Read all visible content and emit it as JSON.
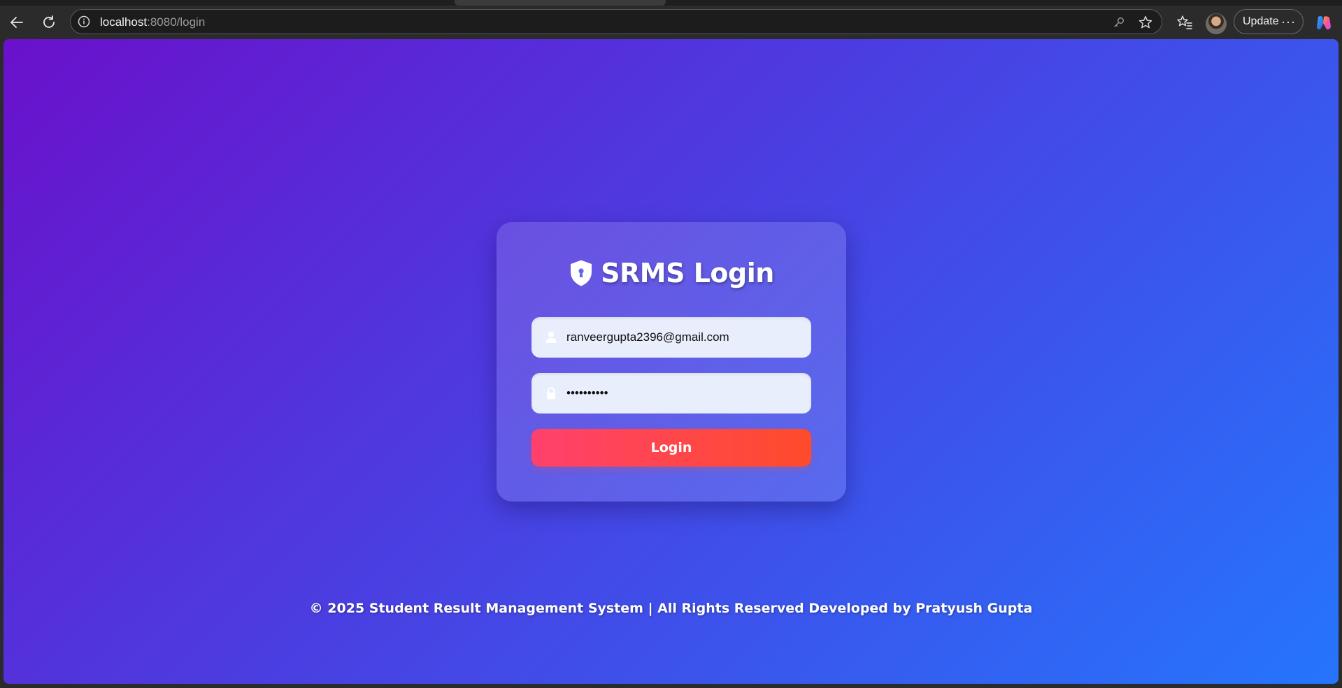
{
  "browser": {
    "url_host": "localhost",
    "url_path": ":8080/login",
    "update_label": "Update",
    "more_label": "···"
  },
  "login": {
    "title": "SRMS Login",
    "email_value": "ranveergupta2396@gmail.com",
    "password_value": "••••••••••",
    "button_label": "Login"
  },
  "footer": {
    "text": "© 2025 Student Result Management System | All Rights Reserved Developed by Pratyush Gupta"
  },
  "colors": {
    "gradient_start": "#6a11cb",
    "gradient_end": "#2575fc",
    "button_start": "#ff416c",
    "button_end": "#ff4b2b"
  },
  "icons": {
    "back": "back-arrow-icon",
    "reload": "reload-icon",
    "site_info": "info-icon",
    "key": "key-icon",
    "favorite": "star-icon",
    "favorites_list": "favorites-icon",
    "copilot": "copilot-icon",
    "title": "shield-lock-icon",
    "email": "user-icon",
    "password": "lock-icon"
  }
}
